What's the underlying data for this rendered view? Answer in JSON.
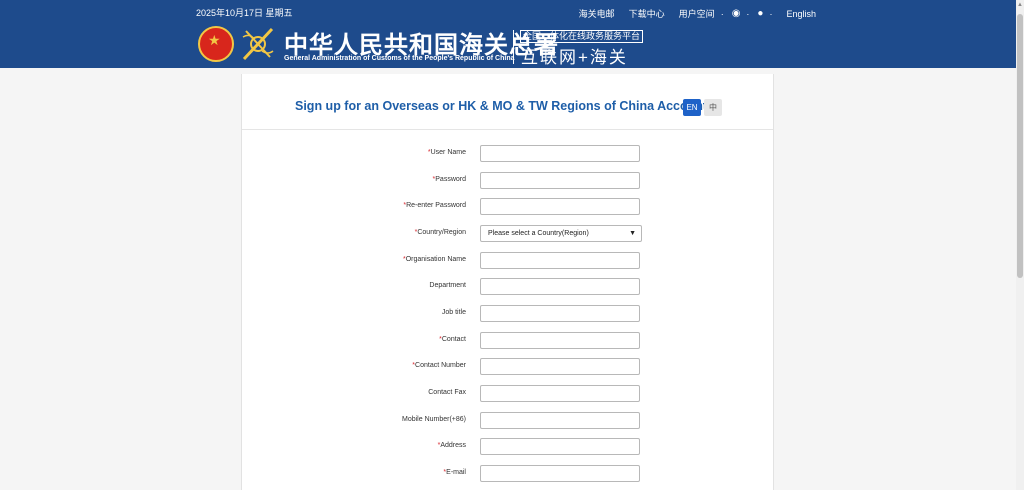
{
  "header": {
    "date": "2025年10月17日  星期五",
    "links": [
      "海关电邮",
      "下载中心",
      "用户空间"
    ],
    "english_link": "English",
    "title_cn": "中华人民共和国海关总署",
    "title_en": "General Administration of Customs of the People's Republic of China",
    "subtitle_box": "全国一体化在线政务服务平台",
    "subtitle_big": "互联网+海关",
    "colors": {
      "bar": "#1e4b8c"
    },
    "icons": [
      "weibo-icon",
      "wechat-icon"
    ]
  },
  "form": {
    "title": "Sign up for an Overseas or HK & MO & TW Regions of China Account",
    "lang_en": "EN",
    "lang_zh": "中",
    "required_mark": "*",
    "fields": [
      {
        "label": "User Name",
        "required": true
      },
      {
        "label": "Password",
        "required": true
      },
      {
        "label": "Re-enter Password",
        "required": true
      },
      {
        "label": "Country/Region",
        "required": true,
        "select_value": "Please select a Country(Region)"
      },
      {
        "label": "Organisation Name",
        "required": true
      },
      {
        "label": "Department",
        "required": false
      },
      {
        "label": "Job title",
        "required": false
      },
      {
        "label": "Contact",
        "required": true
      },
      {
        "label": "Contact Number",
        "required": true
      },
      {
        "label": "Contact Fax",
        "required": false
      },
      {
        "label": "Mobile Number(+86)",
        "required": false
      },
      {
        "label": "Address",
        "required": true
      },
      {
        "label": "E-mail",
        "required": true
      }
    ]
  }
}
